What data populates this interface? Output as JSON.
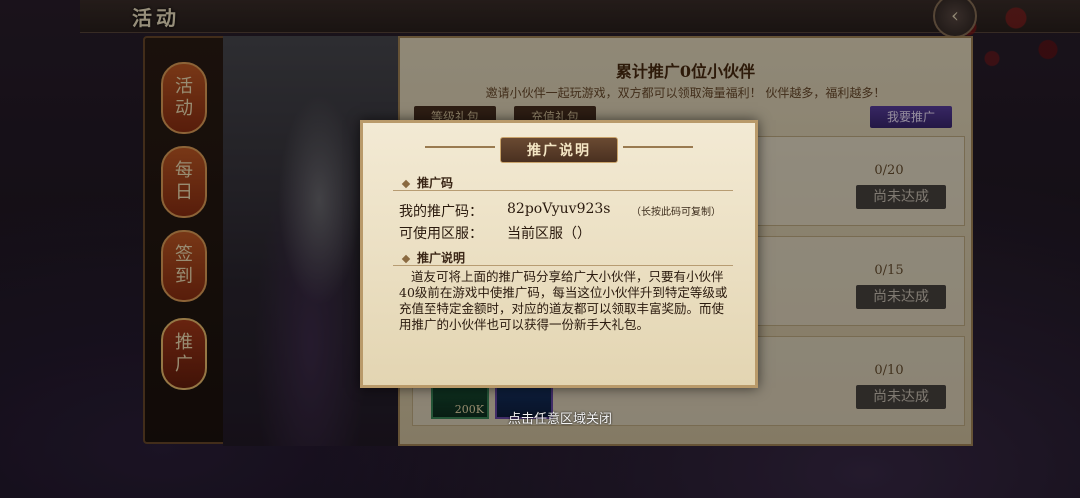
{
  "header": {
    "title": "活动"
  },
  "nav": {
    "tabs": [
      "活动",
      "每日",
      "签到",
      "推广"
    ]
  },
  "main": {
    "heading": "累计推广0位小伙伴",
    "subheading": "邀请小伙伴一起玩游戏，双方都可以领取海量福利！ 伙伴越多，福利越多！",
    "tab_level": "等级礼包",
    "tab_recharge": "充值礼包",
    "promote_button": "我要推广",
    "rows": [
      {
        "count": "0/20",
        "status": "尚未达成"
      },
      {
        "count": "0/15",
        "status": "尚未达成"
      },
      {
        "count": "0/10",
        "status": "尚未达成"
      }
    ],
    "row3_items": [
      {
        "amount": "200K"
      },
      {
        "amount": ""
      }
    ]
  },
  "modal": {
    "title": "推广说明",
    "code_section": "推广码",
    "my_code_label": "我的推广码：",
    "my_code": "82poVyuv923s",
    "copy_hint": "（长按此码可复制）",
    "server_label": "可使用区服：",
    "server_value": "当前区服（）",
    "desc_section": "推广说明",
    "description": "道友可将上面的推广码分享给广大小伙伴，只要有小伙伴40级前在游戏中使推广码，每当这位小伙伴升到特定等级或充值至特定金额时，对应的道友都可以领取丰富奖励。而使用推广的小伙伴也可以获得一份新手大礼包。"
  },
  "close_hint": "点击任意区域关闭",
  "colors": {
    "accent": "#a83a1a",
    "panel": "#e8dcc0",
    "modal": "#f3ead4"
  }
}
